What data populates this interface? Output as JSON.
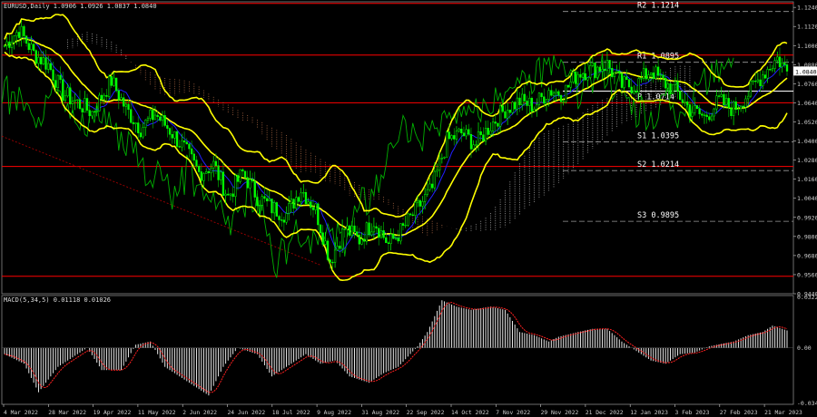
{
  "header": {
    "main_title": "EURUSD,Daily 1.0906 1.0926 1.0837 1.0840",
    "macd_title": "MACD(5,34,5) 0.01118 0.01026"
  },
  "current_price": "1.0840",
  "colors": {
    "background": "#000000",
    "axis": "#cfcfcf",
    "bull_candle": "#00ff00",
    "bear_candle": "#00aa00",
    "bands": "#ffff00",
    "lagging_line": "#00b000",
    "ma_fast": "#2020ff",
    "level_red": "#ff0000",
    "level_white": "#ffffff",
    "kumo_up": "#c8c8c8",
    "kumo_down": "#c87a50",
    "macd_hist": "#e6e6e6",
    "macd_signal": "#ff2020"
  },
  "chart_data": [
    {
      "type": "candlestick",
      "title": "EURUSD,Daily",
      "y_ticks": [
        "1.1240",
        "1.1120",
        "1.1000",
        "1.0880",
        "1.0760",
        "1.0640",
        "1.0520",
        "1.0400",
        "1.0280",
        "1.0160",
        "1.0040",
        "0.9920",
        "0.9800",
        "0.9680",
        "0.9560",
        "0.9440"
      ],
      "ylim": [
        0.944,
        1.1275
      ],
      "x_ticks": [
        "4 Mar 2022",
        "28 Mar 2022",
        "19 Apr 2022",
        "11 May 2022",
        "2 Jun 2022",
        "24 Jun 2022",
        "18 Jul 2022",
        "9 Aug 2022",
        "31 Aug 2022",
        "22 Sep 2022",
        "14 Oct 2022",
        "7 Nov 2022",
        "29 Nov 2022",
        "21 Dec 2022",
        "12 Jan 2023",
        "3 Feb 2023",
        "27 Feb 2023",
        "21 Mar 2023"
      ],
      "pivot_levels": [
        {
          "name": "R2",
          "value": 1.1214,
          "label": "R2 1.1214"
        },
        {
          "name": "R1",
          "value": 1.0895,
          "label": "R1 1.0895"
        },
        {
          "name": "P",
          "value": 1.0714,
          "label": "P 1.0714"
        },
        {
          "name": "S1",
          "value": 1.0395,
          "label": "S1 1.0395"
        },
        {
          "name": "S2",
          "value": 1.0214,
          "label": "S2 1.0214"
        },
        {
          "name": "S3",
          "value": 0.9895,
          "label": "S3 0.9895"
        }
      ],
      "horizontal_levels_red": [
        1.1265,
        1.094,
        1.064,
        1.024,
        0.955
      ],
      "price_path": [
        [
          0,
          1.1
        ],
        [
          6,
          1.11
        ],
        [
          12,
          1.095
        ],
        [
          18,
          1.088
        ],
        [
          24,
          1.07
        ],
        [
          30,
          1.064
        ],
        [
          36,
          1.058
        ],
        [
          44,
          1.078
        ],
        [
          50,
          1.06
        ],
        [
          56,
          1.048
        ],
        [
          62,
          1.057
        ],
        [
          68,
          1.047
        ],
        [
          74,
          1.035
        ],
        [
          80,
          1.02
        ],
        [
          86,
          1.025
        ],
        [
          92,
          1.005
        ],
        [
          98,
          1.02
        ],
        [
          104,
          1.005
        ],
        [
          110,
          0.998
        ],
        [
          116,
          0.994
        ],
        [
          122,
          1.01
        ],
        [
          128,
          0.997
        ],
        [
          134,
          0.965
        ],
        [
          140,
          0.985
        ],
        [
          146,
          0.978
        ],
        [
          152,
          0.99
        ],
        [
          158,
          0.975
        ],
        [
          164,
          0.985
        ],
        [
          170,
          0.998
        ],
        [
          176,
          1.01
        ],
        [
          182,
          1.04
        ],
        [
          188,
          1.045
        ],
        [
          194,
          1.038
        ],
        [
          200,
          1.05
        ],
        [
          206,
          1.06
        ],
        [
          212,
          1.065
        ],
        [
          218,
          1.062
        ],
        [
          224,
          1.072
        ],
        [
          230,
          1.07
        ],
        [
          236,
          1.083
        ],
        [
          242,
          1.085
        ],
        [
          248,
          1.088
        ],
        [
          254,
          1.075
        ],
        [
          260,
          1.075
        ],
        [
          266,
          1.085
        ],
        [
          270,
          1.078
        ],
        [
          276,
          1.072
        ],
        [
          282,
          1.06
        ],
        [
          288,
          1.055
        ],
        [
          294,
          1.065
        ],
        [
          300,
          1.06
        ],
        [
          306,
          1.07
        ],
        [
          312,
          1.082
        ],
        [
          318,
          1.092
        ],
        [
          322,
          1.084
        ]
      ],
      "n_bars": 323
    },
    {
      "type": "bar",
      "title": "MACD(5,34,5)",
      "main": 0.01118,
      "signal": 0.01026,
      "y_ticks": [
        "0.03226",
        "0.00",
        "-0.03463"
      ],
      "ylim": [
        -0.0356,
        0.033
      ],
      "hist_path": [
        [
          0,
          -0.004
        ],
        [
          8,
          -0.01
        ],
        [
          14,
          -0.028
        ],
        [
          22,
          -0.012
        ],
        [
          28,
          -0.006
        ],
        [
          34,
          0.0
        ],
        [
          40,
          -0.014
        ],
        [
          48,
          -0.014
        ],
        [
          54,
          0.002
        ],
        [
          60,
          0.004
        ],
        [
          66,
          -0.012
        ],
        [
          72,
          -0.018
        ],
        [
          80,
          -0.026
        ],
        [
          84,
          -0.03
        ],
        [
          90,
          -0.012
        ],
        [
          96,
          0.0
        ],
        [
          104,
          -0.004
        ],
        [
          110,
          -0.018
        ],
        [
          118,
          -0.01
        ],
        [
          124,
          -0.004
        ],
        [
          130,
          -0.01
        ],
        [
          136,
          -0.008
        ],
        [
          142,
          -0.018
        ],
        [
          150,
          -0.022
        ],
        [
          156,
          -0.016
        ],
        [
          162,
          -0.012
        ],
        [
          170,
          0.001
        ],
        [
          174,
          0.01
        ],
        [
          180,
          0.03
        ],
        [
          186,
          0.026
        ],
        [
          192,
          0.024
        ],
        [
          200,
          0.026
        ],
        [
          206,
          0.024
        ],
        [
          212,
          0.01
        ],
        [
          218,
          0.008
        ],
        [
          224,
          0.004
        ],
        [
          228,
          0.007
        ],
        [
          236,
          0.01
        ],
        [
          242,
          0.012
        ],
        [
          248,
          0.012
        ],
        [
          254,
          0.004
        ],
        [
          260,
          -0.002
        ],
        [
          266,
          -0.008
        ],
        [
          272,
          -0.01
        ],
        [
          278,
          -0.004
        ],
        [
          284,
          -0.003
        ],
        [
          290,
          0.001
        ],
        [
          300,
          0.004
        ],
        [
          306,
          0.008
        ],
        [
          312,
          0.01
        ],
        [
          316,
          0.014
        ],
        [
          322,
          0.011
        ]
      ]
    }
  ]
}
